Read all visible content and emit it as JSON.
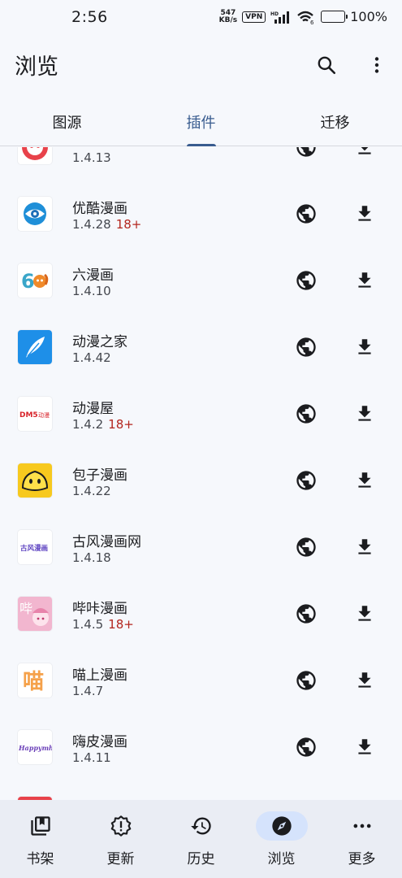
{
  "status": {
    "time": "2:56",
    "netspeed_value": "547",
    "netspeed_unit": "KB/s",
    "vpn": "VPN",
    "battery_pct": "100%"
  },
  "appbar": {
    "title": "浏览",
    "search_icon": "search-icon",
    "more_icon": "more-vert-icon"
  },
  "tabs": [
    {
      "label": "图源"
    },
    {
      "label": "插件",
      "active": true
    },
    {
      "label": "迁移"
    }
  ],
  "extensions": [
    {
      "name": "",
      "version": "1.4.13",
      "nsfw": "",
      "icon": "red-round-app-icon"
    },
    {
      "name": "优酷漫画",
      "version": "1.4.28",
      "nsfw": "18+",
      "icon": "youku-eye-icon"
    },
    {
      "name": "六漫画",
      "version": "1.4.10",
      "nsfw": "",
      "icon": "six-manhua-icon"
    },
    {
      "name": "动漫之家",
      "version": "1.4.42",
      "nsfw": "",
      "icon": "feather-blue-icon"
    },
    {
      "name": "动漫屋",
      "version": "1.4.2",
      "nsfw": "18+",
      "icon": "dm5-logo-icon"
    },
    {
      "name": "包子漫画",
      "version": "1.4.22",
      "nsfw": "",
      "icon": "baozi-icon"
    },
    {
      "name": "古风漫画网",
      "version": "1.4.18",
      "nsfw": "",
      "icon": "gufeng-logo-icon"
    },
    {
      "name": "哔咔漫画",
      "version": "1.4.5",
      "nsfw": "18+",
      "icon": "pica-girl-icon"
    },
    {
      "name": "喵上漫画",
      "version": "1.4.7",
      "nsfw": "",
      "icon": "miao-char-icon"
    },
    {
      "name": "嗨皮漫画",
      "version": "1.4.11",
      "nsfw": "",
      "icon": "happymh-logo-icon"
    },
    {
      "name": "",
      "version": "",
      "nsfw": "",
      "icon": "partial-app-icon"
    }
  ],
  "icon_text": {
    "dm5": "DM5",
    "dm5_suffix": "动漫",
    "gufeng": "古风漫画",
    "miao": "喵",
    "happymh": "Happymh",
    "pica": "哔"
  },
  "bottom_nav": [
    {
      "label": "书架",
      "icon": "library-icon"
    },
    {
      "label": "更新",
      "icon": "updates-badge-icon"
    },
    {
      "label": "历史",
      "icon": "history-icon"
    },
    {
      "label": "浏览",
      "icon": "explore-compass-icon",
      "active": true
    },
    {
      "label": "更多",
      "icon": "more-horiz-icon"
    }
  ],
  "colors": {
    "accent": "#395c8f",
    "nsfw": "#b3261e",
    "nav_active_pill": "#d5e3fc",
    "background": "#f6f8fc"
  }
}
